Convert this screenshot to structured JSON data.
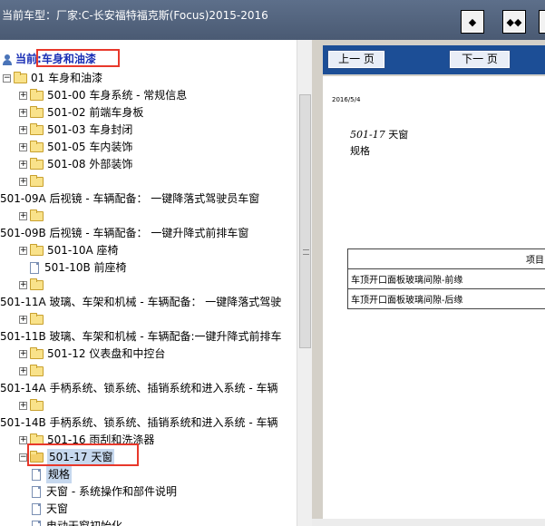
{
  "window": {
    "title": "当前车型：厂家:C-长安福特福克斯(Focus)2015-2016",
    "buttons": {
      "left_pane_glyph": "◆",
      "split_glyph": "◆◆"
    }
  },
  "tree": {
    "current_prefix": "当前",
    "current_value": ":车身和油漆",
    "items": [
      {
        "label": "01 车身和油漆",
        "indent": 1,
        "type": "folder",
        "expander": "−"
      },
      {
        "label": "501-00 车身系统 - 常规信息",
        "indent": 2,
        "type": "folder",
        "expander": "+"
      },
      {
        "label": "501-02 前端车身板",
        "indent": 2,
        "type": "folder",
        "expander": "+"
      },
      {
        "label": "501-03 车身封闭",
        "indent": 2,
        "type": "folder",
        "expander": "+"
      },
      {
        "label": "501-05 车内装饰",
        "indent": 2,
        "type": "folder",
        "expander": "+"
      },
      {
        "label": "501-08 外部装饰",
        "indent": 2,
        "type": "folder",
        "expander": "+"
      },
      {
        "label": "",
        "indent": 2,
        "type": "folder",
        "expander": "+"
      },
      {
        "label": "501-09A 后视镜 - 车辆配备： 一键降落式驾驶员车窗",
        "indent": 0,
        "type": "text",
        "expander": ""
      },
      {
        "label": "",
        "indent": 2,
        "type": "folder",
        "expander": "+"
      },
      {
        "label": "501-09B 后视镜 - 车辆配备： 一键升降式前排车窗",
        "indent": 0,
        "type": "text",
        "expander": ""
      },
      {
        "label": "501-10A 座椅",
        "indent": 2,
        "type": "folder",
        "expander": "+"
      },
      {
        "label": "501-10B 前座椅",
        "indent": 2,
        "type": "doc",
        "expander": ""
      },
      {
        "label": "",
        "indent": 2,
        "type": "folder",
        "expander": "+"
      },
      {
        "label": "501-11A 玻璃、车架和机械 - 车辆配备： 一键降落式驾驶",
        "indent": 0,
        "type": "text",
        "expander": ""
      },
      {
        "label": "",
        "indent": 2,
        "type": "folder",
        "expander": "+"
      },
      {
        "label": "501-11B 玻璃、车架和机械 - 车辆配备:一键升降式前排车",
        "indent": 0,
        "type": "text",
        "expander": ""
      },
      {
        "label": "501-12 仪表盘和中控台",
        "indent": 2,
        "type": "folder",
        "expander": "+"
      },
      {
        "label": "",
        "indent": 2,
        "type": "folder",
        "expander": "+"
      },
      {
        "label": "501-14A 手柄系统、锁系统、插销系统和进入系统 - 车辆",
        "indent": 0,
        "type": "text",
        "expander": ""
      },
      {
        "label": "",
        "indent": 2,
        "type": "folder",
        "expander": "+"
      },
      {
        "label": "501-14B 手柄系统、锁系统、插销系统和进入系统 - 车辆",
        "indent": 0,
        "type": "text",
        "expander": ""
      },
      {
        "label": "501-16 雨刮和洗涤器",
        "indent": 2,
        "type": "folder",
        "expander": "+"
      },
      {
        "label": "501-17 天窗",
        "indent": 2,
        "type": "folder",
        "expander": "−",
        "selected": true
      },
      {
        "label": "规格",
        "indent": 3,
        "type": "doc",
        "expander": "",
        "selected_label": true
      },
      {
        "label": "天窗 - 系统操作和部件说明",
        "indent": 3,
        "type": "doc",
        "expander": ""
      },
      {
        "label": "天窗",
        "indent": 3,
        "type": "doc",
        "expander": ""
      },
      {
        "label": "电动天窗初始化",
        "indent": 3,
        "type": "doc",
        "expander": ""
      }
    ]
  },
  "viewer": {
    "prev_label": "上一 页",
    "next_label": "下一 页",
    "date": "2016/5/4",
    "section_num": "501-17",
    "section_name": " 天窗",
    "subtitle": "规格",
    "table": {
      "header": "项目",
      "rows": [
        "车顶开口面板玻璃间隙-前缘",
        "车顶开口面板玻璃间隙-后缘"
      ]
    }
  }
}
